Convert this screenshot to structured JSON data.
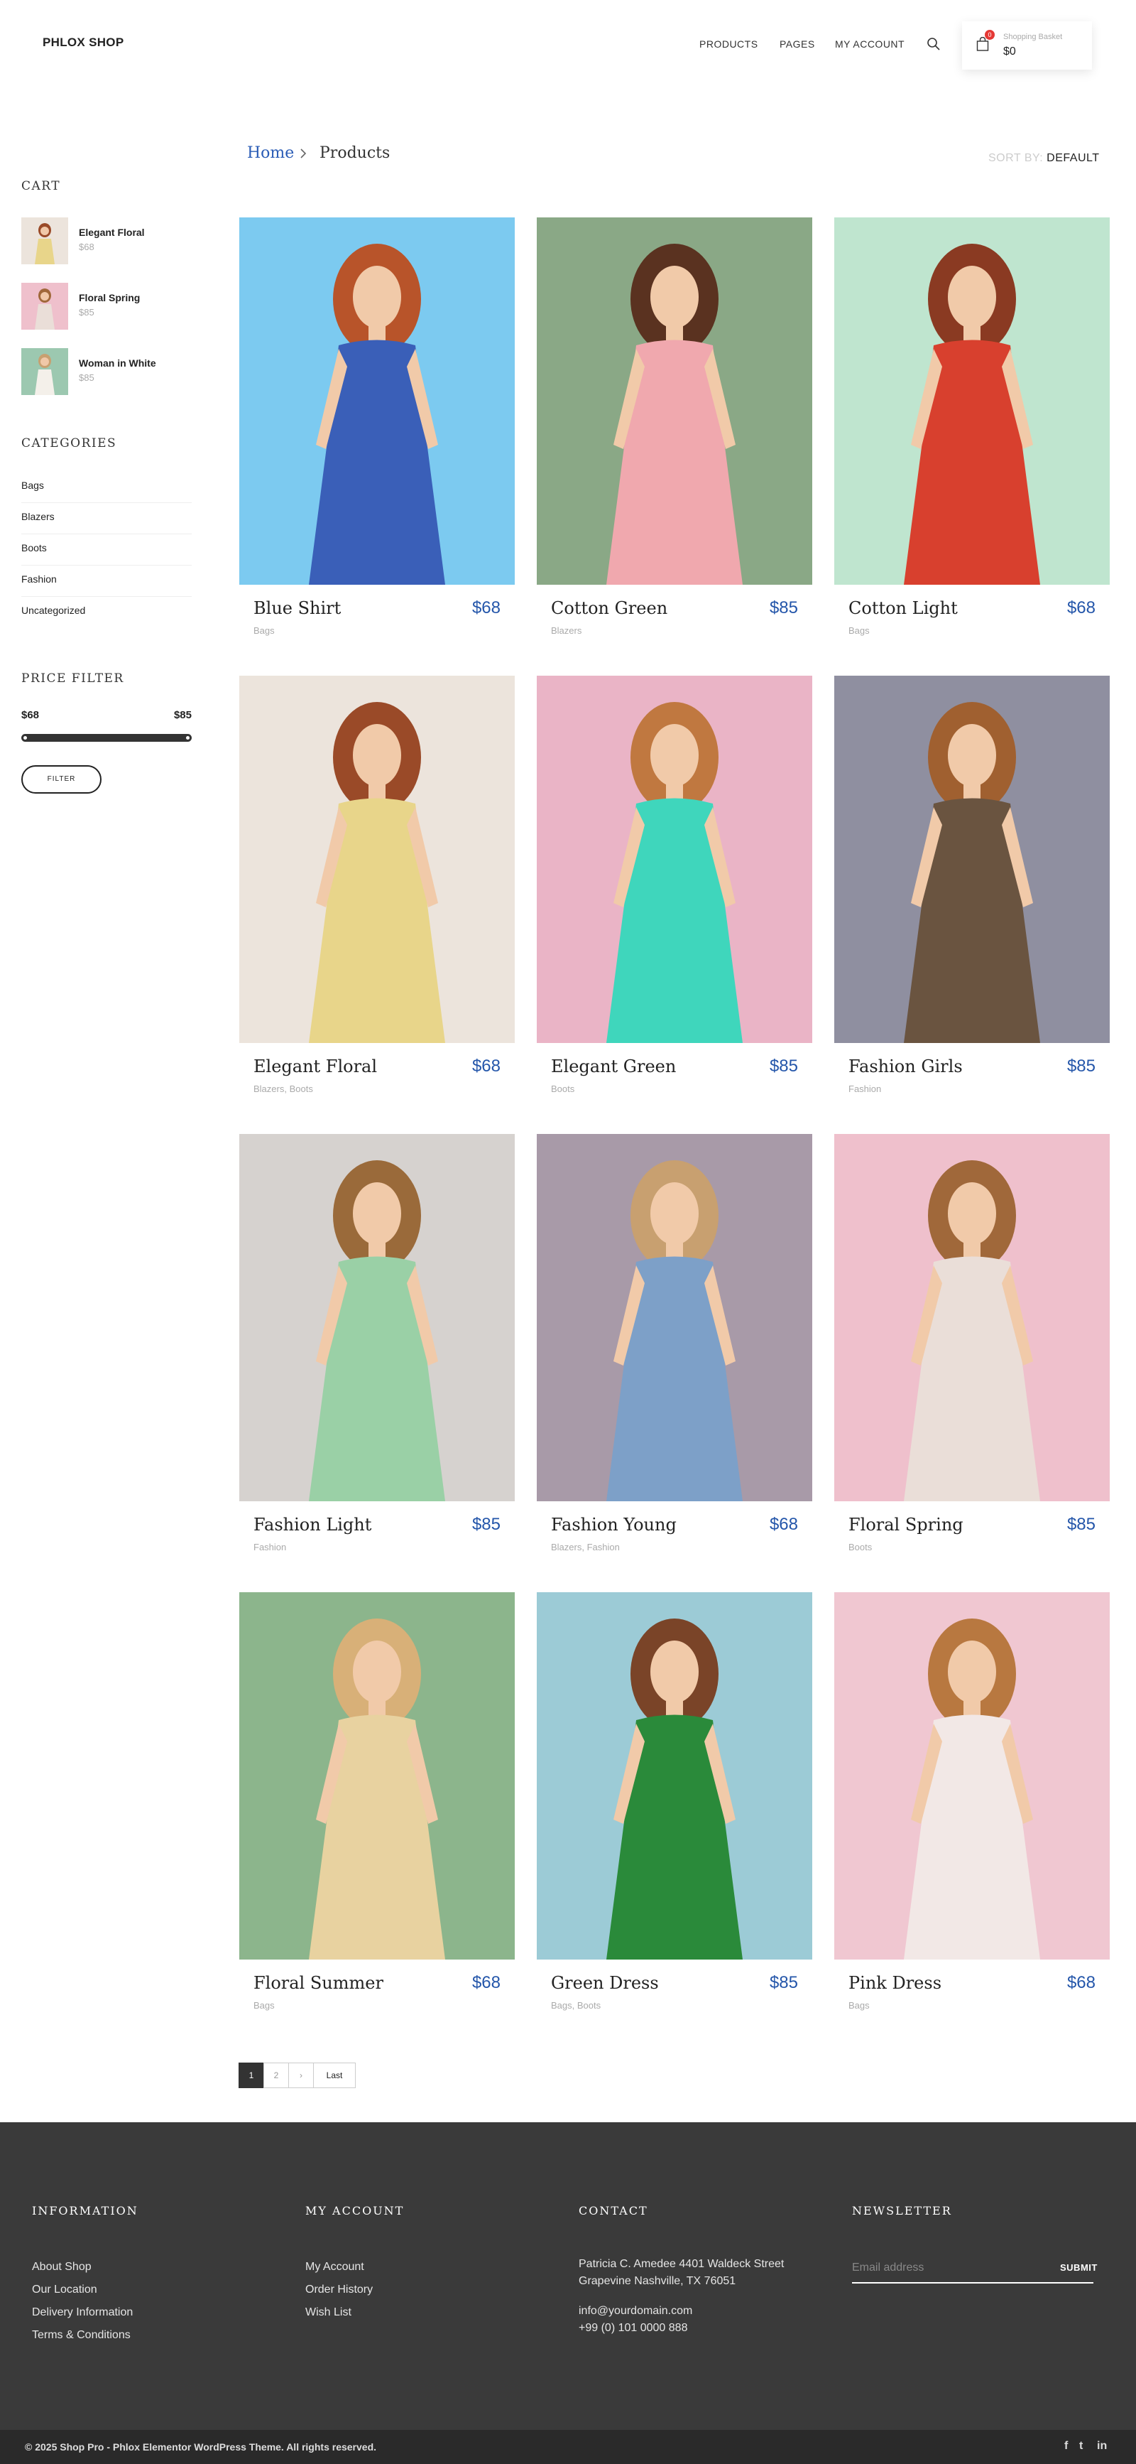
{
  "header": {
    "logo": "PHLOX SHOP",
    "nav": [
      "PRODUCTS",
      "PAGES",
      "MY ACCOUNT"
    ],
    "basket": {
      "count": "0",
      "label": "Shopping Basket",
      "total": "$0"
    }
  },
  "sidebar": {
    "cart_title": "CART",
    "cart_items": [
      {
        "name": "Elegant Floral",
        "price": "$68"
      },
      {
        "name": "Floral Spring",
        "price": "$85"
      },
      {
        "name": "Woman in White",
        "price": "$85"
      }
    ],
    "categories_title": "CATEGORIES",
    "categories": [
      "Bags",
      "Blazers",
      "Boots",
      "Fashion",
      "Uncategorized"
    ],
    "price_filter_title": "PRICE FILTER",
    "price_min": "$68",
    "price_max": "$85",
    "filter_button": "FILTER"
  },
  "breadcrumb": {
    "home": "Home",
    "current": "Products"
  },
  "sort": {
    "label": "SORT BY:",
    "value": "DEFAULT"
  },
  "products": [
    {
      "name": "Blue Shirt",
      "price": "$68",
      "cats": "Bags"
    },
    {
      "name": "Cotton Green",
      "price": "$85",
      "cats": "Blazers"
    },
    {
      "name": "Cotton Light",
      "price": "$68",
      "cats": "Bags"
    },
    {
      "name": "Elegant Floral",
      "price": "$68",
      "cats": "Blazers, Boots"
    },
    {
      "name": "Elegant Green",
      "price": "$85",
      "cats": "Boots"
    },
    {
      "name": "Fashion Girls",
      "price": "$85",
      "cats": "Fashion"
    },
    {
      "name": "Fashion Light",
      "price": "$85",
      "cats": "Fashion"
    },
    {
      "name": "Fashion Young",
      "price": "$68",
      "cats": "Blazers, Fashion"
    },
    {
      "name": "Floral Spring",
      "price": "$85",
      "cats": "Boots"
    },
    {
      "name": "Floral Summer",
      "price": "$68",
      "cats": "Bags"
    },
    {
      "name": "Green Dress",
      "price": "$85",
      "cats": "Bags, Boots"
    },
    {
      "name": "Pink Dress",
      "price": "$68",
      "cats": "Bags"
    }
  ],
  "pagination": {
    "current": "1",
    "next_page": "2",
    "next_arrow": "›",
    "last": "Last"
  },
  "footer": {
    "information_title": "INFORMATION",
    "information_links": [
      "About Shop",
      "Our Location",
      "Delivery Information",
      "Terms & Conditions"
    ],
    "account_title": "MY ACCOUNT",
    "account_links": [
      "My Account",
      "Order History",
      "Wish List"
    ],
    "contact_title": "CONTACT",
    "address_line1": "Patricia C. Amedee 4401 Waldeck Street",
    "address_line2": "Grapevine Nashville, TX 76051",
    "email": "info@yourdomain.com",
    "phone": "+99 (0) 101 0000 888",
    "newsletter_title": "NEWSLETTER",
    "email_placeholder": "Email address",
    "submit_label": "SUBMIT",
    "copyright": "© 2025 Shop Pro - Phlox Elementor WordPress Theme. All rights reserved.",
    "social": [
      "f",
      "t",
      "in"
    ]
  },
  "colors": {
    "accent_price": "#2456aa",
    "breadcrumb_link": "#2a5cb6",
    "footer_bg": "#3a3a3a",
    "bottom_bar_bg": "#2a2a2a",
    "badge": "#e53935"
  },
  "photo_backgrounds": [
    "#7ccaf0",
    "#8aa886",
    "#bfe5cf",
    "#ece4dc",
    "#eab4c6",
    "#8f8fa0",
    "#d6d2cf",
    "#a89aa8",
    "#efc0cc",
    "#8cb58c",
    "#9ccbd6",
    "#f0c7d1"
  ],
  "photo_dresses": [
    "#3a5fb8",
    "#f0a8ae",
    "#d8402e",
    "#e8d58a",
    "#3fd6bc",
    "#6a5440",
    "#9ad0a6",
    "#7da0c8",
    "#eaded8",
    "#e8d2a0",
    "#2a8a3a",
    "#f2e8e6"
  ],
  "photo_hair": [
    "#b8542a",
    "#5a3220",
    "#8a3a22",
    "#9a4a28",
    "#c07840",
    "#a06030",
    "#9a6a3a",
    "#c8a070",
    "#a0683a",
    "#d8b078",
    "#7a4428",
    "#b87840"
  ],
  "icons": [
    "search-icon",
    "shopping-bag-icon",
    "chevron-right-icon",
    "facebook-icon",
    "twitter-icon",
    "linkedin-icon"
  ]
}
